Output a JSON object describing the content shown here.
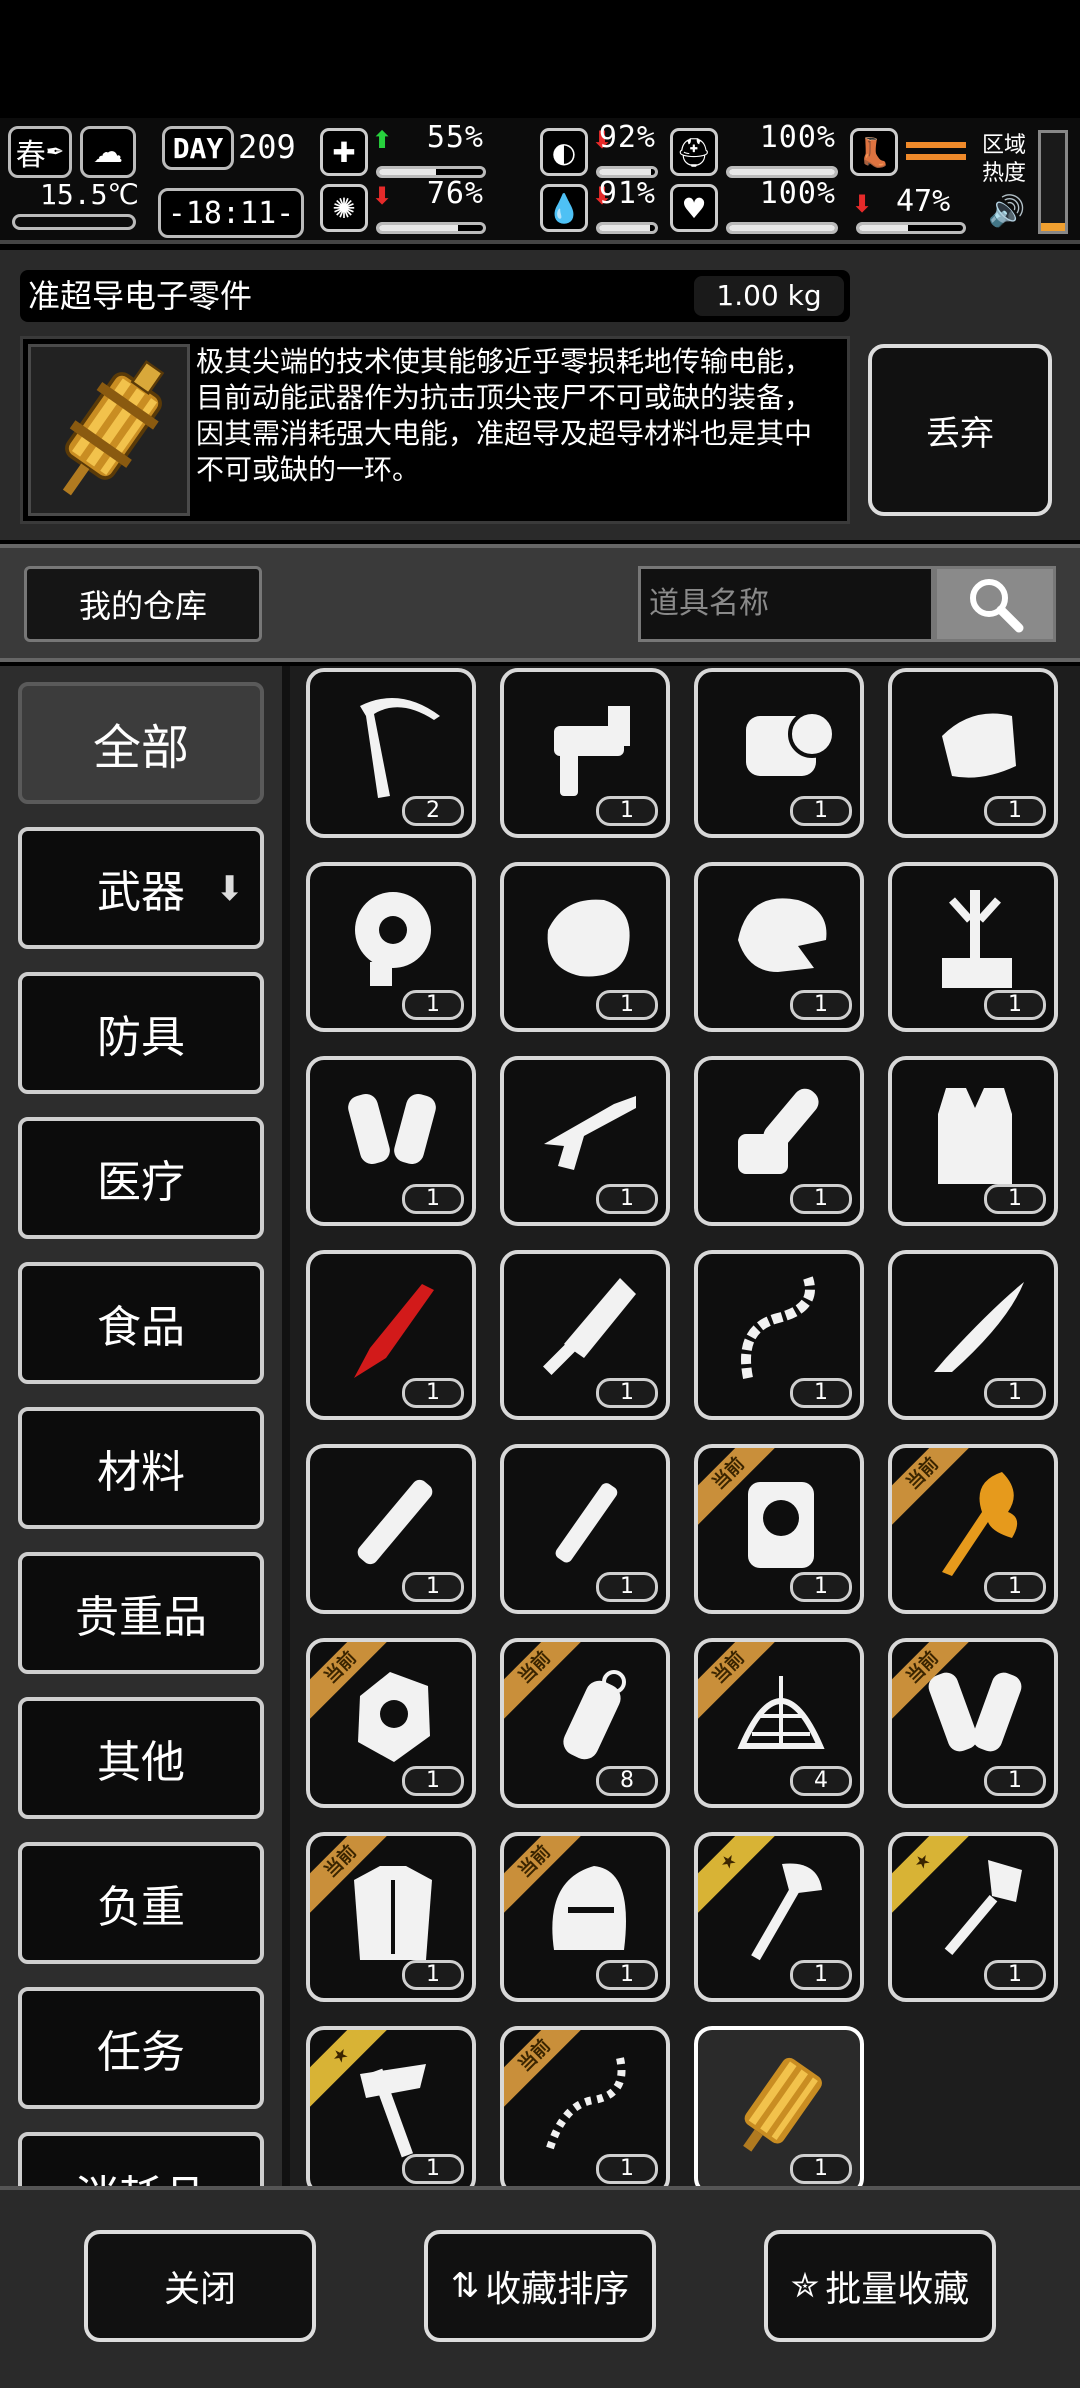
{
  "status": {
    "season": "春",
    "day_label": "DAY",
    "day": "209",
    "temperature": "15.5℃",
    "time": "-18:11-",
    "stats": [
      {
        "id": "health",
        "icon": "medkit-icon",
        "trend": "up",
        "value": "55%",
        "level": 0.55
      },
      {
        "id": "hunger",
        "icon": "stomach-icon",
        "trend": "down",
        "value": "92%",
        "level": 0.92
      },
      {
        "id": "armor",
        "icon": "helmet-icon",
        "trend": "none",
        "value": "100%",
        "level": 1.0
      },
      {
        "id": "mood",
        "icon": "brain-icon",
        "trend": "down",
        "value": "76%",
        "level": 0.76
      },
      {
        "id": "thirst",
        "icon": "water-drop-icon",
        "trend": "down",
        "value": "91%",
        "level": 0.91
      },
      {
        "id": "heart",
        "icon": "heart-icon",
        "trend": "none",
        "value": "100%",
        "level": 1.0
      }
    ],
    "stamina": {
      "icon": "boot-icon",
      "value": "47%",
      "level": 0.47
    },
    "zone_heat_label": "区域\n热度"
  },
  "item": {
    "name": "准超导电子零件",
    "weight": "1.00 kg",
    "description": "极其尖端的技术使其能够近乎零损耗地传输电能，目前动能武器作为抗击顶尖丧尸不可或缺的装备，因其需消耗强大电能，准超导及超导材料也是其中不可或缺的一环。",
    "discard_label": "丢弃"
  },
  "search": {
    "warehouse_label": "我的仓库",
    "placeholder": "道具名称"
  },
  "categories": [
    {
      "label": "全部",
      "active": true
    },
    {
      "label": "武器",
      "dropdown": true
    },
    {
      "label": "防具"
    },
    {
      "label": "医疗"
    },
    {
      "label": "食品"
    },
    {
      "label": "材料"
    },
    {
      "label": "贵重品"
    },
    {
      "label": "其他"
    },
    {
      "label": "负重"
    },
    {
      "label": "任务"
    },
    {
      "label": "消耗品"
    }
  ],
  "ribbon_equipped": "当前",
  "items": [
    {
      "name": "ice-axe-icon",
      "count": "2"
    },
    {
      "name": "nail-gun-icon",
      "count": "1"
    },
    {
      "name": "jetpack-device-icon",
      "count": "1"
    },
    {
      "name": "shoulder-armor-icon",
      "count": "1"
    },
    {
      "name": "tape-roll-icon",
      "count": "1"
    },
    {
      "name": "raw-meat-icon",
      "count": "1"
    },
    {
      "name": "dinosaur-head-icon",
      "count": "1"
    },
    {
      "name": "tripod-toolbox-icon",
      "count": "1"
    },
    {
      "name": "arm-guards-icon",
      "count": "1"
    },
    {
      "name": "shotgun-icon",
      "count": "1"
    },
    {
      "name": "chainsaw-icon",
      "count": "1"
    },
    {
      "name": "vest-icon",
      "count": "1"
    },
    {
      "name": "red-crystal-blade-icon",
      "count": "1"
    },
    {
      "name": "cleaver-icon",
      "count": "1"
    },
    {
      "name": "bone-whip-icon",
      "count": "1"
    },
    {
      "name": "machete-icon",
      "count": "1"
    },
    {
      "name": "glow-stick-icon",
      "count": "1"
    },
    {
      "name": "cylinder-tube-icon",
      "count": "1"
    },
    {
      "name": "mech-backpack-icon",
      "count": "1",
      "ribbon": "equip"
    },
    {
      "name": "golden-flame-staff-icon",
      "count": "1",
      "ribbon": "equip"
    },
    {
      "name": "armored-glove-icon",
      "count": "1",
      "ribbon": "equip"
    },
    {
      "name": "grenade-icon",
      "count": "8",
      "ribbon": "equip"
    },
    {
      "name": "energy-net-icon",
      "count": "4",
      "ribbon": "equip"
    },
    {
      "name": "bracers-icon",
      "count": "1",
      "ribbon": "equip"
    },
    {
      "name": "chest-armor-icon",
      "count": "1",
      "ribbon": "equip"
    },
    {
      "name": "knight-helmet-icon",
      "count": "1",
      "ribbon": "equip"
    },
    {
      "name": "axe-icon",
      "count": "1",
      "ribbon": "fav"
    },
    {
      "name": "shovel-icon",
      "count": "1",
      "ribbon": "fav"
    },
    {
      "name": "hatchet-hammer-icon",
      "count": "1",
      "ribbon": "fav"
    },
    {
      "name": "chain-whip-icon",
      "count": "1",
      "ribbon": "equip"
    },
    {
      "name": "superconductor-part-icon",
      "count": "1",
      "selected": true
    }
  ],
  "bottom": {
    "close_label": "关闭",
    "sort_label": "收藏排序",
    "batch_label": "批量收藏"
  }
}
